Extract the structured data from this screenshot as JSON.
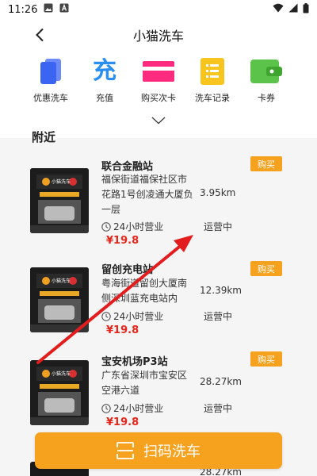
{
  "status_bar": {
    "time": "11:26"
  },
  "header": {
    "title": "小猫洗车"
  },
  "quick_menu": {
    "items": [
      {
        "label": "优惠洗车",
        "icon": "card-stack-icon",
        "color": "#3b64f3"
      },
      {
        "label": "充值",
        "icon_text": "充",
        "icon": "recharge-icon",
        "color": "#2a8ff0"
      },
      {
        "label": "购买次卡",
        "icon": "pink-card-icon",
        "color": "#ff2b7f"
      },
      {
        "label": "洗车记录",
        "icon": "record-list-icon",
        "color": "#f7c51e"
      },
      {
        "label": "卡券",
        "icon": "wallet-icon",
        "color": "#5cc34a"
      }
    ]
  },
  "nearby": {
    "title": "附近",
    "stations": [
      {
        "name": "联合金融站",
        "address": "福保街道福保社区市花路1号创凌通大厦负一层",
        "distance": "3.95km",
        "hours": "24小时营业",
        "status": "运营中",
        "price": "¥19.8",
        "buy_label": "购买",
        "thumb_label": "小猫洗车"
      },
      {
        "name": "留创充电站",
        "address": "粤海街道留创大厦南侧深圳蓝充电站内",
        "distance": "12.39km",
        "hours": "24小时营业",
        "status": "运营中",
        "price": "¥19.8",
        "buy_label": "购买",
        "thumb_label": "小猫洗车"
      },
      {
        "name": "宝安机场P3站",
        "address": "广东省深圳市宝安区空港六道",
        "distance": "28.27km",
        "hours": "24小时营业",
        "status": "运营中",
        "price": "¥19.8",
        "buy_label": "购买",
        "thumb_label": "小猫洗车"
      }
    ],
    "peek_distance": "28.27km"
  },
  "scan_button": {
    "label": "扫码洗车"
  },
  "colors": {
    "accent_orange": "#f7a21f",
    "price_red": "#e8251a",
    "annotation_red": "#e31d1d"
  }
}
